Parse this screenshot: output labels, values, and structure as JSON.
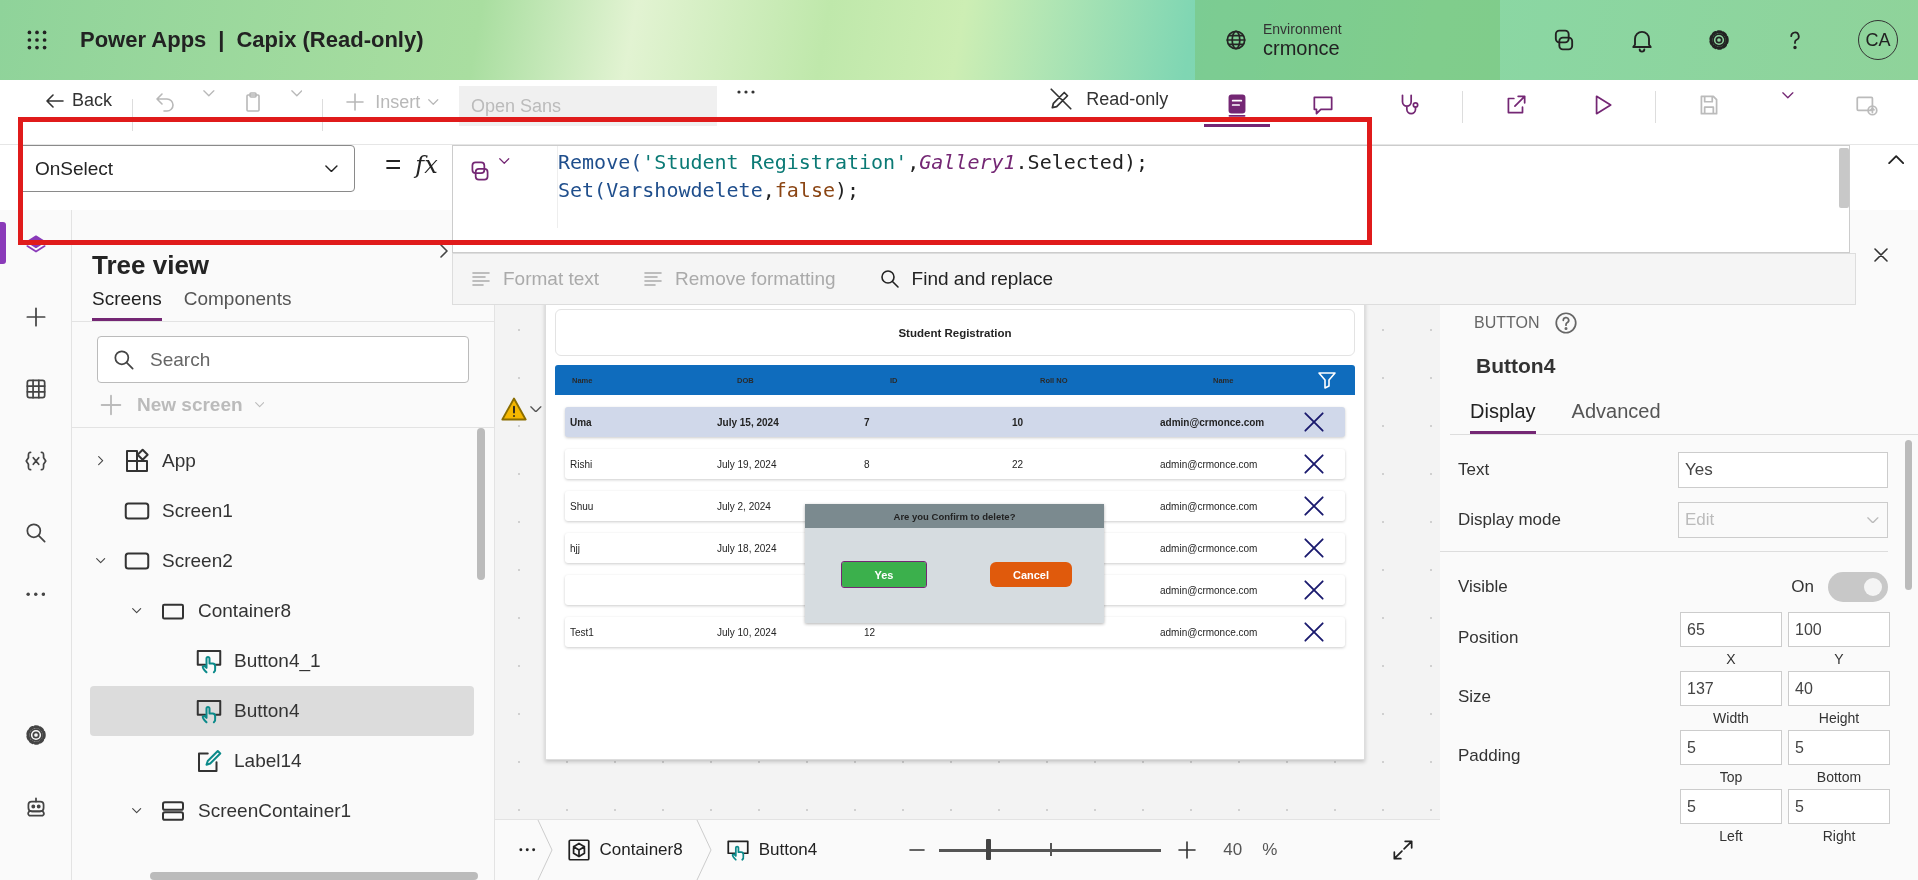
{
  "header": {
    "app_name": "Power Apps",
    "separator": "|",
    "app_title": "Capix (Read-only)",
    "environment_label": "Environment",
    "environment_name": "crmonce",
    "avatar": "CA"
  },
  "command_bar": {
    "left": [
      {
        "kind": "back",
        "label": "Back",
        "disabled": false
      },
      {
        "kind": "undo",
        "disabled": true
      },
      {
        "kind": "caret",
        "disabled": true
      },
      {
        "kind": "paste",
        "disabled": true
      },
      {
        "kind": "caret",
        "disabled": true
      },
      {
        "kind": "insert",
        "label": "Insert",
        "disabled": true
      },
      {
        "kind": "font",
        "label": "Open Sans",
        "disabled": true
      },
      {
        "kind": "more",
        "disabled": false
      }
    ],
    "mode": "Read-only",
    "right": [
      {
        "kind": "checker",
        "selected": true,
        "disabled": false
      },
      {
        "kind": "comment",
        "selected": false,
        "disabled": false
      },
      {
        "kind": "health",
        "selected": false,
        "disabled": false
      },
      {
        "kind": "share",
        "selected": false,
        "disabled": false
      },
      {
        "kind": "play",
        "selected": false,
        "disabled": false
      },
      {
        "kind": "save",
        "selected": false,
        "disabled": true
      },
      {
        "kind": "caret",
        "selected": false,
        "disabled": false
      },
      {
        "kind": "publish",
        "selected": false,
        "disabled": true
      }
    ]
  },
  "formula_bar": {
    "property": "OnSelect",
    "equals": "=",
    "fx": "fx",
    "code_lines": [
      [
        {
          "text": "Remove(",
          "kind": "function"
        },
        {
          "text": "'Student Registration'",
          "kind": "string"
        },
        {
          "text": ",",
          "kind": "punct"
        },
        {
          "text": "Gallery1",
          "kind": "control"
        },
        {
          "text": ".Selected);",
          "kind": "punct"
        }
      ],
      [
        {
          "text": "Set(",
          "kind": "function"
        },
        {
          "text": "Varshowdelete",
          "kind": "variable"
        },
        {
          "text": ",",
          "kind": "punct"
        },
        {
          "text": "false",
          "kind": "keyword"
        },
        {
          "text": ");",
          "kind": "punct"
        }
      ]
    ],
    "tools": [
      {
        "kind": "format",
        "label": "Format text",
        "disabled": true
      },
      {
        "kind": "unformat",
        "label": "Remove formatting",
        "disabled": true
      },
      {
        "kind": "find",
        "label": "Find and replace",
        "disabled": false
      }
    ]
  },
  "left_rail": [
    {
      "kind": "tree",
      "selected": true
    },
    {
      "kind": "insert",
      "selected": false
    },
    {
      "kind": "data",
      "selected": false
    },
    {
      "kind": "variables",
      "selected": false
    },
    {
      "kind": "search",
      "selected": false
    },
    {
      "kind": "more",
      "selected": false
    },
    {
      "kind": "settings",
      "selected": false
    },
    {
      "kind": "bot",
      "selected": false
    }
  ],
  "tree_view": {
    "title": "Tree view",
    "tabs": [
      {
        "label": "Screens",
        "selected": true
      },
      {
        "label": "Components",
        "selected": false
      }
    ],
    "search_placeholder": "Search",
    "new_screen": "New screen",
    "items": [
      {
        "label": "App",
        "kind": "app",
        "expanded": false,
        "selected": false
      },
      {
        "label": "Screen1",
        "kind": "screen",
        "selected": false
      },
      {
        "label": "Screen2",
        "kind": "screen",
        "expanded": true,
        "selected": false,
        "children": [
          {
            "label": "Container8",
            "kind": "container",
            "expanded": true,
            "selected": false,
            "children": [
              {
                "label": "Button4_1",
                "kind": "button",
                "selected": false
              },
              {
                "label": "Button4",
                "kind": "button",
                "selected": true
              },
              {
                "label": "Label14",
                "kind": "label",
                "selected": false
              }
            ]
          },
          {
            "label": "ScreenContainer1",
            "kind": "stack",
            "expanded": true,
            "selected": false
          }
        ]
      }
    ]
  },
  "canvas": {
    "title": "Student Registration",
    "columns": [
      "Name",
      "DOB",
      "ID",
      "Roll NO",
      "Name"
    ],
    "rows": [
      {
        "name": "Uma",
        "dob": "July 15, 2024",
        "id": "7",
        "roll_no": "10",
        "email": "admin@crmonce.com",
        "selected": true
      },
      {
        "name": "Rishi",
        "dob": "July 19, 2024",
        "id": "8",
        "roll_no": "22",
        "email": "admin@crmonce.com",
        "selected": false
      },
      {
        "name": "Shuu",
        "dob": "July 2, 2024",
        "email": "admin@crmonce.com",
        "selected": false
      },
      {
        "name": "hjj",
        "dob": "July 18, 2024",
        "email": "admin@crmonce.com",
        "selected": false
      },
      {
        "email": "admin@crmonce.com",
        "selected": false
      },
      {
        "name": "Test1",
        "dob": "July 10, 2024",
        "id": "12",
        "email": "admin@crmonce.com",
        "selected": false
      }
    ],
    "dialog": {
      "title": "Are you Confirm to delete?",
      "confirm": "Yes",
      "cancel": "Cancel",
      "confirm_selected": true
    }
  },
  "properties": {
    "type": "BUTTON",
    "name": "Button4",
    "tabs": [
      {
        "label": "Display",
        "selected": true
      },
      {
        "label": "Advanced",
        "selected": false
      }
    ],
    "text_label": "Text",
    "text_value": "Yes",
    "display_mode_label": "Display mode",
    "display_mode_value": "Edit",
    "visible_label": "Visible",
    "visible_state": "On",
    "visible": true,
    "groups": [
      {
        "label": "Position",
        "fields": [
          {
            "value": "65",
            "caption": "X"
          },
          {
            "value": "100",
            "caption": "Y"
          }
        ]
      },
      {
        "label": "Size",
        "fields": [
          {
            "value": "137",
            "caption": "Width"
          },
          {
            "value": "40",
            "caption": "Height"
          }
        ]
      },
      {
        "label": "Padding",
        "fields": [
          {
            "value": "5",
            "caption": "Top"
          },
          {
            "value": "5",
            "caption": "Bottom"
          },
          {
            "value": "5",
            "caption": "Left"
          },
          {
            "value": "5",
            "caption": "Right"
          }
        ]
      }
    ]
  },
  "bottom_bar": {
    "breadcrumb": [
      {
        "label": "Container8",
        "kind": "container"
      },
      {
        "label": "Button4",
        "kind": "button"
      }
    ],
    "zoom": {
      "level": 0.22,
      "value": "40",
      "unit": "%"
    }
  }
}
